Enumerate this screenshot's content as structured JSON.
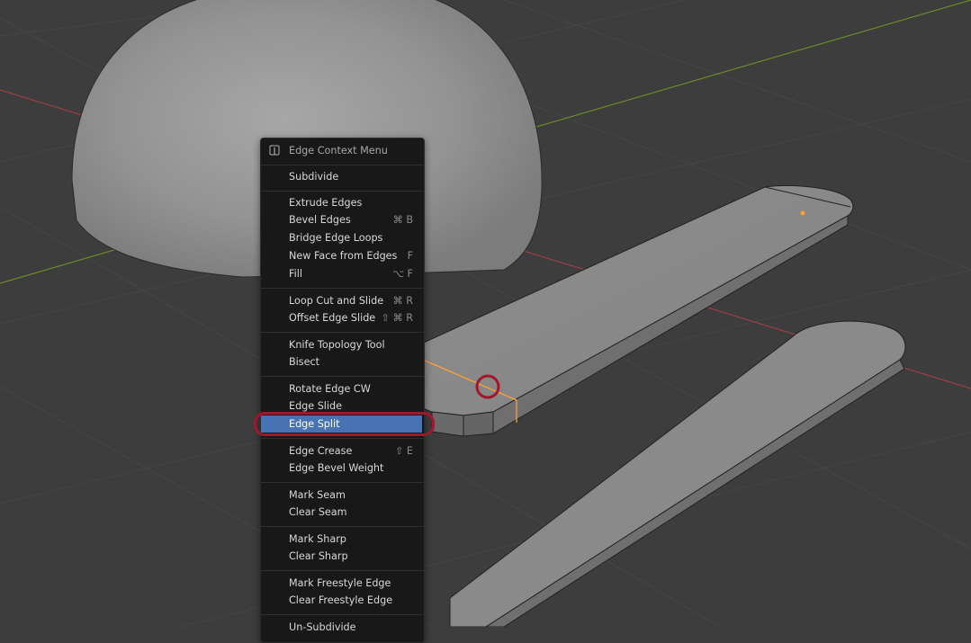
{
  "menu": {
    "title": "Edge Context Menu",
    "header_icon": "edge-menu-icon",
    "items": [
      {
        "label": "Subdivide",
        "shortcut": ""
      },
      {
        "label": "Extrude Edges",
        "shortcut": ""
      },
      {
        "label": "Bevel Edges",
        "shortcut": "⌘ B"
      },
      {
        "label": "Bridge Edge Loops",
        "shortcut": ""
      },
      {
        "label": "New Face from Edges",
        "shortcut": "F"
      },
      {
        "label": "Fill",
        "shortcut": "⌥ F"
      },
      {
        "label": "Loop Cut and Slide",
        "shortcut": "⌘ R"
      },
      {
        "label": "Offset Edge Slide",
        "shortcut": "⇧ ⌘ R"
      },
      {
        "label": "Knife Topology Tool",
        "shortcut": ""
      },
      {
        "label": "Bisect",
        "shortcut": ""
      },
      {
        "label": "Rotate Edge CW",
        "shortcut": ""
      },
      {
        "label": "Edge Slide",
        "shortcut": ""
      },
      {
        "label": "Edge Split",
        "shortcut": ""
      },
      {
        "label": "Edge Crease",
        "shortcut": "⇧ E"
      },
      {
        "label": "Edge Bevel Weight",
        "shortcut": ""
      },
      {
        "label": "Mark Seam",
        "shortcut": ""
      },
      {
        "label": "Clear Seam",
        "shortcut": ""
      },
      {
        "label": "Mark Sharp",
        "shortcut": ""
      },
      {
        "label": "Clear Sharp",
        "shortcut": ""
      },
      {
        "label": "Mark Freestyle Edge",
        "shortcut": ""
      },
      {
        "label": "Clear Freestyle Edge",
        "shortcut": ""
      },
      {
        "label": "Un-Subdivide",
        "shortcut": ""
      }
    ],
    "highlighted_item": "Edge Split"
  },
  "colors": {
    "viewport_bg": "#3d3d3d",
    "grid": "#464646",
    "axis_x": "#9c3e46",
    "axis_y": "#6b8a2a",
    "selection_orange": "#ffa033",
    "menu_highlight": "#4772b3",
    "annotation_red": "#a3162b"
  }
}
